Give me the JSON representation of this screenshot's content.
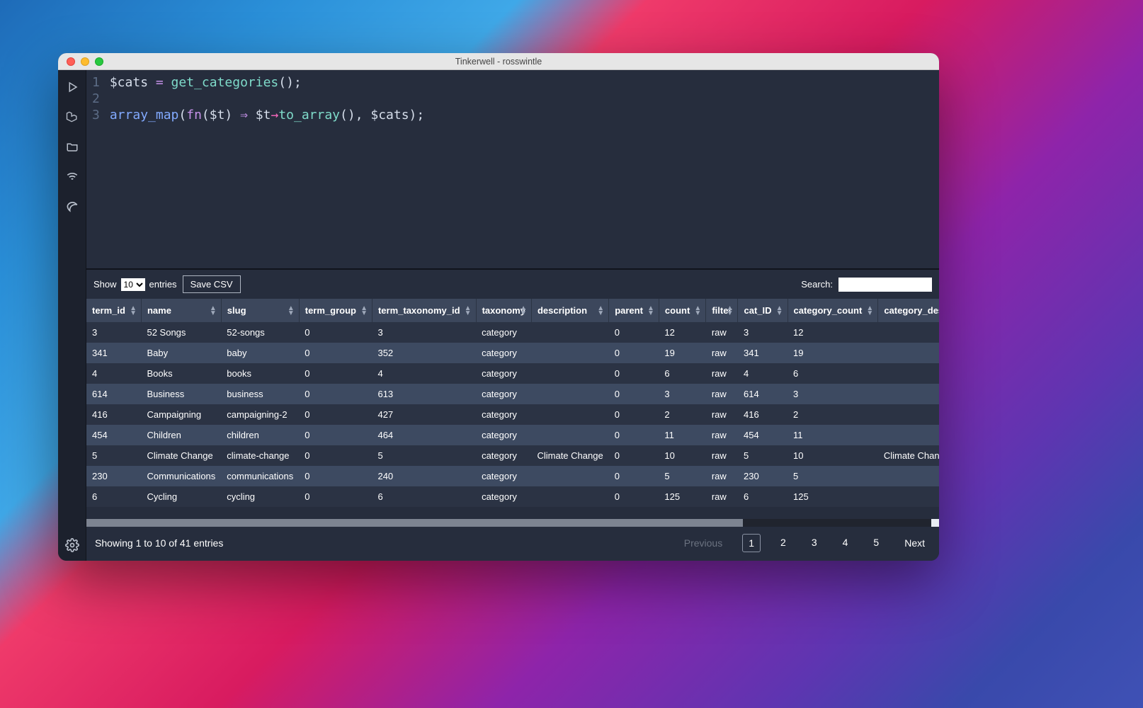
{
  "window": {
    "title": "Tinkerwell - rosswintle"
  },
  "editor": {
    "lines": [
      "1",
      "2",
      "3"
    ],
    "tokens": {
      "l1": {
        "var": "$cats",
        "eq": " = ",
        "fn": "get_categories",
        "paren": "();"
      },
      "l3": {
        "fn": "array_map",
        "open": "(",
        "kw": "fn",
        "args": "($t) ",
        "arrow": "⇒",
        "sp": " $t",
        "thinarrow": "→",
        "method": "to_array",
        "tail": "(), $cats);"
      }
    }
  },
  "controls": {
    "show_label": "Show",
    "show_value": "10",
    "entries_label": "entries",
    "save_csv": "Save CSV",
    "search_label": "Search:"
  },
  "columns": [
    "term_id",
    "name",
    "slug",
    "term_group",
    "term_taxonomy_id",
    "taxonomy",
    "description",
    "parent",
    "count",
    "filter",
    "cat_ID",
    "category_count",
    "category_description"
  ],
  "rows": [
    {
      "term_id": "3",
      "name": "52 Songs",
      "slug": "52-songs",
      "term_group": "0",
      "term_taxonomy_id": "3",
      "taxonomy": "category",
      "description": "",
      "parent": "0",
      "count": "12",
      "filter": "raw",
      "cat_ID": "3",
      "category_count": "12",
      "category_description": ""
    },
    {
      "term_id": "341",
      "name": "Baby",
      "slug": "baby",
      "term_group": "0",
      "term_taxonomy_id": "352",
      "taxonomy": "category",
      "description": "",
      "parent": "0",
      "count": "19",
      "filter": "raw",
      "cat_ID": "341",
      "category_count": "19",
      "category_description": ""
    },
    {
      "term_id": "4",
      "name": "Books",
      "slug": "books",
      "term_group": "0",
      "term_taxonomy_id": "4",
      "taxonomy": "category",
      "description": "",
      "parent": "0",
      "count": "6",
      "filter": "raw",
      "cat_ID": "4",
      "category_count": "6",
      "category_description": ""
    },
    {
      "term_id": "614",
      "name": "Business",
      "slug": "business",
      "term_group": "0",
      "term_taxonomy_id": "613",
      "taxonomy": "category",
      "description": "",
      "parent": "0",
      "count": "3",
      "filter": "raw",
      "cat_ID": "614",
      "category_count": "3",
      "category_description": ""
    },
    {
      "term_id": "416",
      "name": "Campaigning",
      "slug": "campaigning-2",
      "term_group": "0",
      "term_taxonomy_id": "427",
      "taxonomy": "category",
      "description": "",
      "parent": "0",
      "count": "2",
      "filter": "raw",
      "cat_ID": "416",
      "category_count": "2",
      "category_description": ""
    },
    {
      "term_id": "454",
      "name": "Children",
      "slug": "children",
      "term_group": "0",
      "term_taxonomy_id": "464",
      "taxonomy": "category",
      "description": "",
      "parent": "0",
      "count": "11",
      "filter": "raw",
      "cat_ID": "454",
      "category_count": "11",
      "category_description": ""
    },
    {
      "term_id": "5",
      "name": "Climate Change",
      "slug": "climate-change",
      "term_group": "0",
      "term_taxonomy_id": "5",
      "taxonomy": "category",
      "description": "Climate Change",
      "parent": "0",
      "count": "10",
      "filter": "raw",
      "cat_ID": "5",
      "category_count": "10",
      "category_description": "Climate Change"
    },
    {
      "term_id": "230",
      "name": "Communications",
      "slug": "communications",
      "term_group": "0",
      "term_taxonomy_id": "240",
      "taxonomy": "category",
      "description": "",
      "parent": "0",
      "count": "5",
      "filter": "raw",
      "cat_ID": "230",
      "category_count": "5",
      "category_description": ""
    },
    {
      "term_id": "6",
      "name": "Cycling",
      "slug": "cycling",
      "term_group": "0",
      "term_taxonomy_id": "6",
      "taxonomy": "category",
      "description": "",
      "parent": "0",
      "count": "125",
      "filter": "raw",
      "cat_ID": "6",
      "category_count": "125",
      "category_description": ""
    }
  ],
  "footer": {
    "info": "Showing 1 to 10 of 41 entries",
    "prev": "Previous",
    "pages": [
      "1",
      "2",
      "3",
      "4",
      "5"
    ],
    "current_page": "1",
    "next": "Next"
  }
}
